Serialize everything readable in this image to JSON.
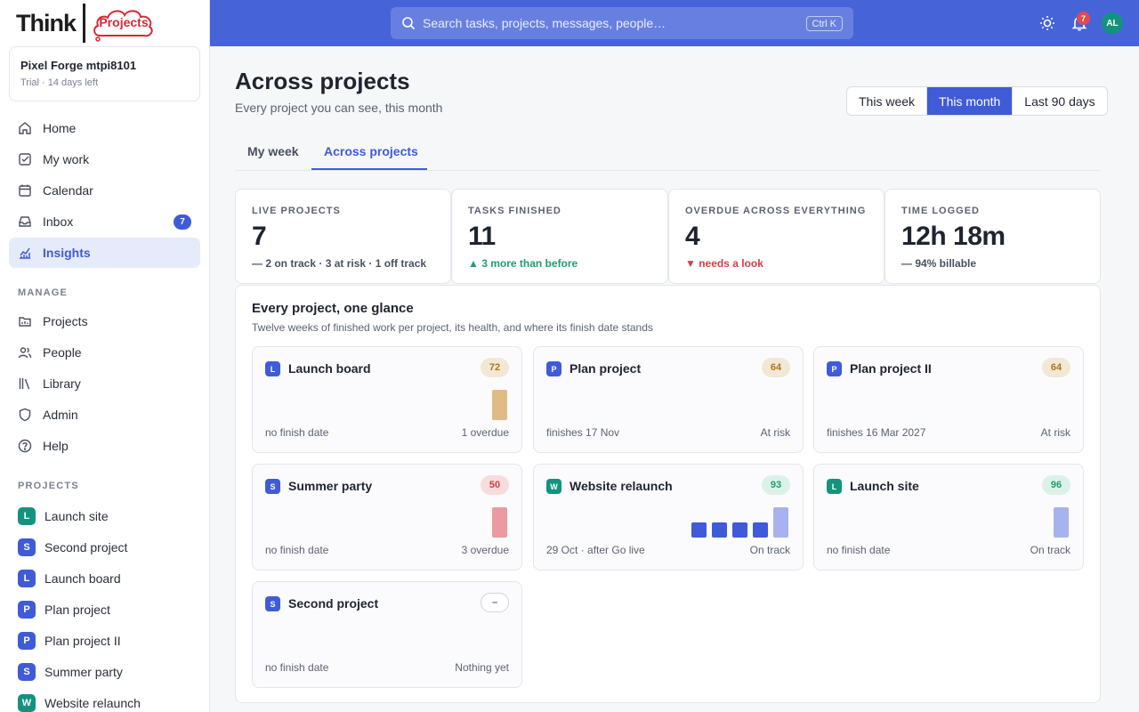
{
  "brand": {
    "name": "Think",
    "product": "Projects"
  },
  "workspace": {
    "name": "Pixel Forge mtpi8101",
    "status": "Trial · 14 days left"
  },
  "nav": [
    {
      "label": "Home",
      "icon": "home-icon"
    },
    {
      "label": "My work",
      "icon": "checkbox-icon"
    },
    {
      "label": "Calendar",
      "icon": "calendar-icon"
    },
    {
      "label": "Inbox",
      "icon": "inbox-icon",
      "badge": "7"
    },
    {
      "label": "Insights",
      "icon": "chart-icon",
      "active": true
    }
  ],
  "manage": {
    "label": "MANAGE",
    "items": [
      {
        "label": "Projects",
        "icon": "folder-icon"
      },
      {
        "label": "People",
        "icon": "people-icon"
      },
      {
        "label": "Library",
        "icon": "library-icon"
      },
      {
        "label": "Admin",
        "icon": "shield-icon"
      },
      {
        "label": "Help",
        "icon": "help-icon"
      }
    ]
  },
  "projects_nav": {
    "label": "PROJECTS",
    "items": [
      {
        "label": "Launch site",
        "initial": "L",
        "color": "#13937e"
      },
      {
        "label": "Second project",
        "initial": "S",
        "color": "#3f5bd8"
      },
      {
        "label": "Launch board",
        "initial": "L",
        "color": "#3f5bd8"
      },
      {
        "label": "Plan project",
        "initial": "P",
        "color": "#3f5bd8"
      },
      {
        "label": "Plan project II",
        "initial": "P",
        "color": "#3f5bd8"
      },
      {
        "label": "Summer party",
        "initial": "S",
        "color": "#3f5bd8"
      },
      {
        "label": "Website relaunch",
        "initial": "W",
        "color": "#13937e"
      }
    ]
  },
  "topbar": {
    "search_placeholder": "Search tasks, projects, messages, people…",
    "shortcut": "Ctrl K",
    "notifications": "7",
    "avatar": "AL"
  },
  "page": {
    "title": "Across projects",
    "subtitle": "Every project you can see, this month",
    "ranges": [
      "This week",
      "This month",
      "Last 90 days"
    ],
    "active_range": "This month",
    "tabs": [
      "My week",
      "Across projects"
    ],
    "active_tab": "Across projects"
  },
  "kpis": [
    {
      "label": "LIVE PROJECTS",
      "value": "7",
      "note": "— 2 on track · 3 at risk · 1 off track",
      "tone": "neutral"
    },
    {
      "label": "TASKS FINISHED",
      "value": "11",
      "note": "▲ 3 more than before",
      "tone": "up"
    },
    {
      "label": "OVERDUE ACROSS EVERYTHING",
      "value": "4",
      "note": "▼ needs a look",
      "tone": "down"
    },
    {
      "label": "TIME LOGGED",
      "value": "12h 18m",
      "note": "— 94% billable",
      "tone": "neutral"
    }
  ],
  "overview": {
    "title": "Every project, one glance",
    "subtitle": "Twelve weeks of finished work per project, its health, and where its finish date stands",
    "cards": [
      {
        "name": "Launch board",
        "initial": "L",
        "color": "#3f5bd8",
        "score": "72",
        "tone": "amber",
        "finish": "no finish date",
        "status": "1 overdue",
        "bar_color": "#dfbb85",
        "weeks": [
          0,
          0,
          0,
          0,
          0,
          0,
          0,
          0,
          0,
          0,
          0,
          1
        ]
      },
      {
        "name": "Plan project",
        "initial": "P",
        "color": "#3f5bd8",
        "score": "64",
        "tone": "amber",
        "finish": "finishes 17 Nov",
        "status": "At risk",
        "bar_color": "#dfbb85",
        "weeks": [
          0,
          0,
          0,
          0,
          0,
          0,
          0,
          0,
          0,
          0,
          0,
          0
        ]
      },
      {
        "name": "Plan project II",
        "initial": "P",
        "color": "#3f5bd8",
        "score": "64",
        "tone": "amber",
        "finish": "finishes 16 Mar 2027",
        "status": "At risk",
        "bar_color": "#dfbb85",
        "weeks": [
          0,
          0,
          0,
          0,
          0,
          0,
          0,
          0,
          0,
          0,
          0,
          0
        ]
      },
      {
        "name": "Summer party",
        "initial": "S",
        "color": "#3f5bd8",
        "score": "50",
        "tone": "red",
        "finish": "no finish date",
        "status": "3 overdue",
        "bar_color": "#ea9aa0",
        "weeks": [
          0,
          0,
          0,
          0,
          0,
          0,
          0,
          0,
          0,
          0,
          0,
          1
        ]
      },
      {
        "name": "Website relaunch",
        "initial": "W",
        "color": "#13937e",
        "score": "93",
        "tone": "green",
        "finish": "29 Oct · after Go live",
        "status": "On track",
        "bar_color": "#3f5bd8",
        "weeks": [
          0,
          0,
          0,
          0,
          0,
          0,
          0,
          0.5,
          0.5,
          0.5,
          0.5,
          1
        ]
      },
      {
        "name": "Launch site",
        "initial": "L",
        "color": "#13937e",
        "score": "96",
        "tone": "green",
        "finish": "no finish date",
        "status": "On track",
        "bar_color": "#a6b3ef",
        "weeks": [
          0,
          0,
          0,
          0,
          0,
          0,
          0,
          0,
          0,
          0,
          0,
          1
        ]
      },
      {
        "name": "Second project",
        "initial": "S",
        "color": "#3f5bd8",
        "score": "–",
        "tone": "none",
        "finish": "no finish date",
        "status": "Nothing yet",
        "bar_color": "#a6b3ef",
        "weeks": [
          0,
          0,
          0,
          0,
          0,
          0,
          0,
          0,
          0,
          0,
          0,
          0
        ]
      }
    ]
  }
}
